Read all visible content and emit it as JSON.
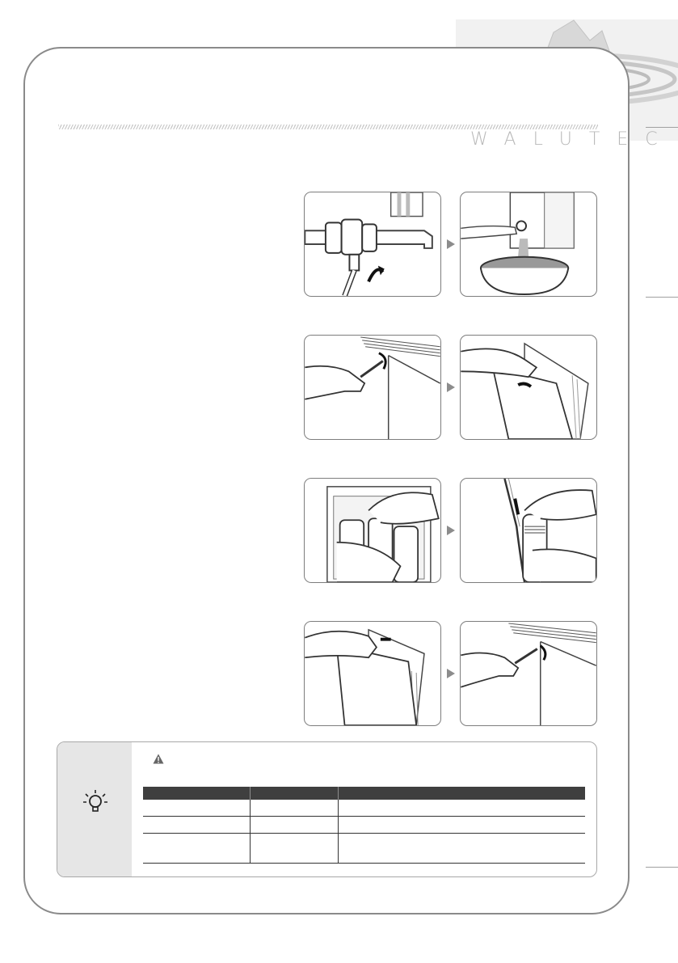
{
  "brand": {
    "name": "WALUTEC"
  },
  "icons": {
    "tip": "lightbulb-icon",
    "warning": "warning-triangle-icon",
    "step_arrow": "play-arrow-icon"
  },
  "illustrations": [
    "water-valve-closing-illustration",
    "dispensing-water-into-bowl-illustration",
    "loosening-panel-screw-illustration",
    "removing-side-panel-illustration",
    "grasping-filter-illustration",
    "detaching-filter-tube-illustration",
    "reattaching-side-panel-illustration",
    "tightening-panel-screw-illustration"
  ],
  "table": {
    "columns": 3,
    "rows": 3
  },
  "colors": {
    "frame": "#8a8a8a",
    "tip_sidebar": "#e6e6e6",
    "table_header": "#3f3f3f",
    "logo_grey": "#b8b8b8"
  }
}
